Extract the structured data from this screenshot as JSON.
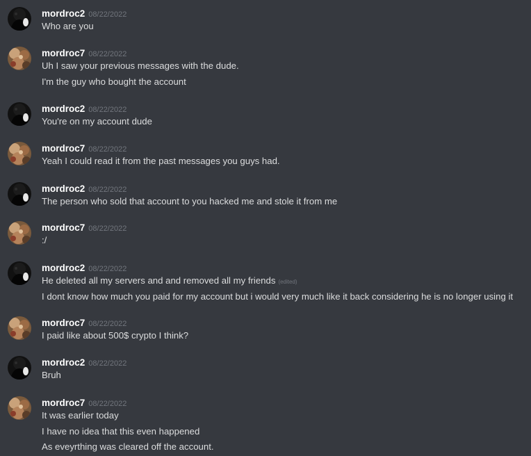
{
  "colors": {
    "background": "#36393f",
    "username": "#ffffff",
    "timestamp": "#72767d",
    "message_text": "#dcddde"
  },
  "messages": [
    {
      "author": "mordroc2",
      "avatar_icon": "dark-avatar-icon",
      "timestamp": "08/22/2022",
      "lines": [
        "Who are you"
      ]
    },
    {
      "author": "mordroc7",
      "avatar_icon": "tan-avatar-icon",
      "timestamp": "08/22/2022",
      "lines": [
        "Uh I saw your previous messages with the dude.",
        "I'm the guy who bought the account"
      ]
    },
    {
      "author": "mordroc2",
      "avatar_icon": "dark-avatar-icon",
      "timestamp": "08/22/2022",
      "lines": [
        "You're on my account dude"
      ]
    },
    {
      "author": "mordroc7",
      "avatar_icon": "tan-avatar-icon",
      "timestamp": "08/22/2022",
      "lines": [
        "Yeah I could read it from the past messages you guys had."
      ]
    },
    {
      "author": "mordroc2",
      "avatar_icon": "dark-avatar-icon",
      "timestamp": "08/22/2022",
      "lines": [
        "The person who sold that account to you hacked me and stole it from me"
      ]
    },
    {
      "author": "mordroc7",
      "avatar_icon": "tan-avatar-icon",
      "timestamp": "08/22/2022",
      "lines": [
        ":/"
      ]
    },
    {
      "author": "mordroc2",
      "avatar_icon": "dark-avatar-icon",
      "timestamp": "08/22/2022",
      "lines": [
        "He deleted all my servers and and removed all my friends",
        "I dont know how much you paid for my account but i would very much like it back considering he is no longer using it"
      ],
      "edited_label": "(edited)"
    },
    {
      "author": "mordroc7",
      "avatar_icon": "tan-avatar-icon",
      "timestamp": "08/22/2022",
      "lines": [
        "I paid like about 500$ crypto I think?"
      ]
    },
    {
      "author": "mordroc2",
      "avatar_icon": "dark-avatar-icon",
      "timestamp": "08/22/2022",
      "lines": [
        "Bruh"
      ]
    },
    {
      "author": "mordroc7",
      "avatar_icon": "tan-avatar-icon",
      "timestamp": "08/22/2022",
      "lines": [
        "It was earlier today",
        "I have no idea that this even happened",
        "As eveyrthing was cleared off the account."
      ]
    }
  ]
}
